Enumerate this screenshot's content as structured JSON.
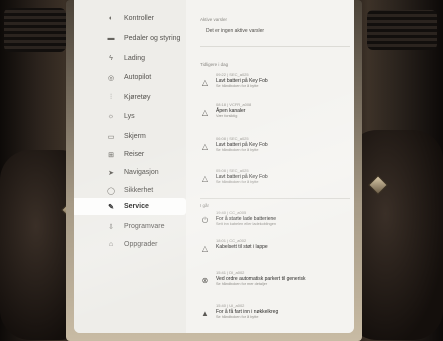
{
  "sidebar": {
    "items": [
      {
        "label": "Kontroller",
        "icon": "toggle-icon",
        "glyph": "◐"
      },
      {
        "label": "Pedaler og styring",
        "icon": "car-icon",
        "glyph": "▬"
      },
      {
        "label": "Lading",
        "icon": "lightning-icon",
        "glyph": "ϟ"
      },
      {
        "label": "Autopilot",
        "icon": "steering-wheel-icon",
        "glyph": "◎"
      },
      {
        "label": "Kjøretøy",
        "icon": "sliders-icon",
        "glyph": "⫶"
      },
      {
        "label": "Lys",
        "icon": "bulb-icon",
        "glyph": "☼"
      },
      {
        "label": "Skjerm",
        "icon": "display-icon",
        "glyph": "▭"
      },
      {
        "label": "Reiser",
        "icon": "trips-icon",
        "glyph": "⊞"
      },
      {
        "label": "Navigasjon",
        "icon": "navigation-icon",
        "glyph": "➤"
      },
      {
        "label": "Sikkerhet",
        "icon": "shield-icon",
        "glyph": "◯"
      },
      {
        "label": "Service",
        "icon": "wrench-icon",
        "glyph": "✎"
      },
      {
        "label": "Programvare",
        "icon": "download-icon",
        "glyph": "⇩"
      },
      {
        "label": "Oppgrader",
        "icon": "bag-icon",
        "glyph": "⌂"
      }
    ],
    "active_index": 10
  },
  "content": {
    "active_alerts_header": "Aktive varsler",
    "no_active_alerts": "Det er ingen aktive varsler",
    "recent_alerts_header": "Tidligere i dag",
    "earlier_header": "I går",
    "today_alerts": [
      {
        "code": "09:22 | SEC_a025",
        "title": "Lavt batteri på Key Fob",
        "sub": "Se håndboken for å bytte",
        "icon": "warning-icon",
        "glyph": "△"
      },
      {
        "code": "08:18 | VCFR_a008",
        "title": "Åpen kanaler",
        "sub": "Vær forsiktig",
        "icon": "warning-icon",
        "glyph": "△"
      },
      {
        "code": "06:08 | SEC_a025",
        "title": "Lavt batteri på Key Fob",
        "sub": "Se håndboken for å bytte",
        "icon": "warning-icon",
        "glyph": "△"
      },
      {
        "code": "05:08 | SEC_a025",
        "title": "Lavt batteri på Key Fob",
        "sub": "Se håndboken for å bytte",
        "icon": "warning-icon",
        "glyph": "△"
      }
    ],
    "earlier_alerts": [
      {
        "code": "19:40 | CC_a005",
        "title": "For å starte lade batteriene",
        "sub": "Sett inn kabelen eller ladekoblingen",
        "icon": "plug-icon",
        "glyph": "⏻"
      },
      {
        "code": "18:01 | CC_a002",
        "title": "Kabelsett til støt i lappe",
        "sub": "",
        "icon": "warning-icon",
        "glyph": "△"
      },
      {
        "code": "15:41 | DI_a002",
        "title": "Ved ordre automatisk parkert til generisk",
        "sub": "Se håndboken for mer detaljer",
        "icon": "car-alert-icon",
        "glyph": "⊗"
      },
      {
        "code": "15:40 | UI_a002",
        "title": "For å få fart inn i nøkkelkreg",
        "sub": "Se håndboken for å bytte",
        "icon": "car-icon",
        "glyph": "▲"
      }
    ]
  }
}
